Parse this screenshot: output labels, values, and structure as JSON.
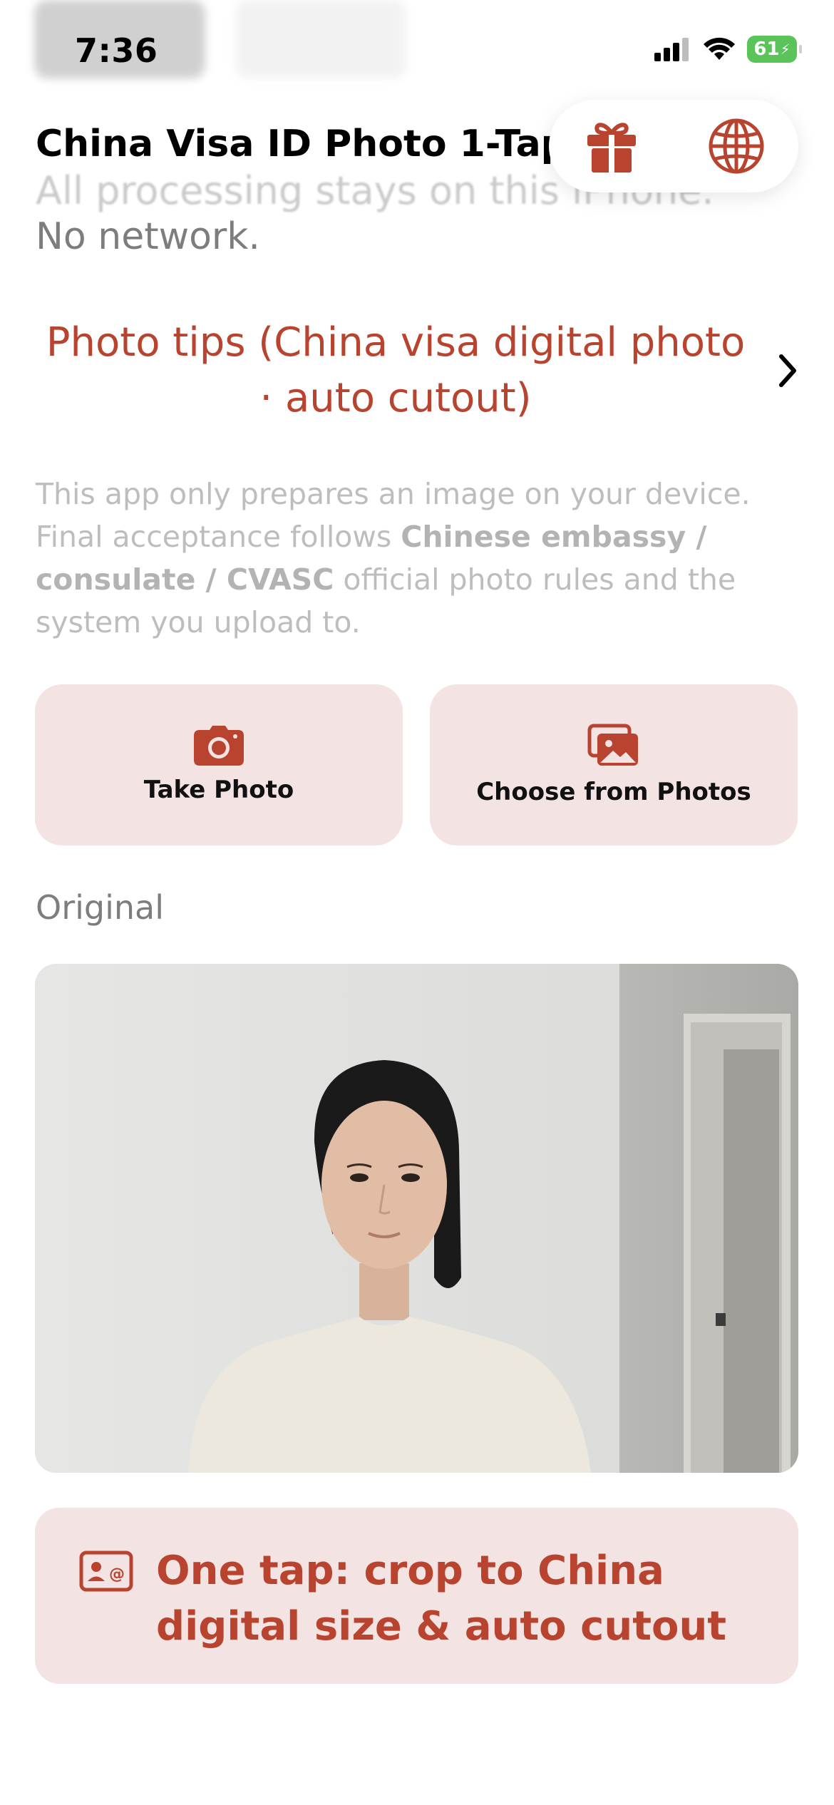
{
  "status_bar": {
    "time": "7:36",
    "battery": "61"
  },
  "header": {
    "title": "China Visa ID Photo 1-Tap",
    "subtitle_faded": "All processing stays on this iPhone.",
    "network_status": "No network.",
    "gift_icon": "gift-icon",
    "language_icon": "globe-icon"
  },
  "tips": {
    "label": "Photo tips (China visa digital photo · auto cutout)",
    "chevron_icon": "chevron-right-icon"
  },
  "disclaimer": {
    "part1": "This app only prepares an image on your device. Final acceptance follows ",
    "bold": "Chinese embassy / consulate / CVASC",
    "part2": " official photo rules and the system you upload to."
  },
  "actions": {
    "take_photo": "Take Photo",
    "choose_photos": "Choose from Photos"
  },
  "original_section": {
    "label": "Original"
  },
  "cta": {
    "label": "One tap: crop to China digital size & auto cutout",
    "icon": "id-card-icon"
  },
  "colors": {
    "accent": "#b8432f",
    "button_bg": "#f3e3e2",
    "muted_text": "#7d7d7d"
  }
}
